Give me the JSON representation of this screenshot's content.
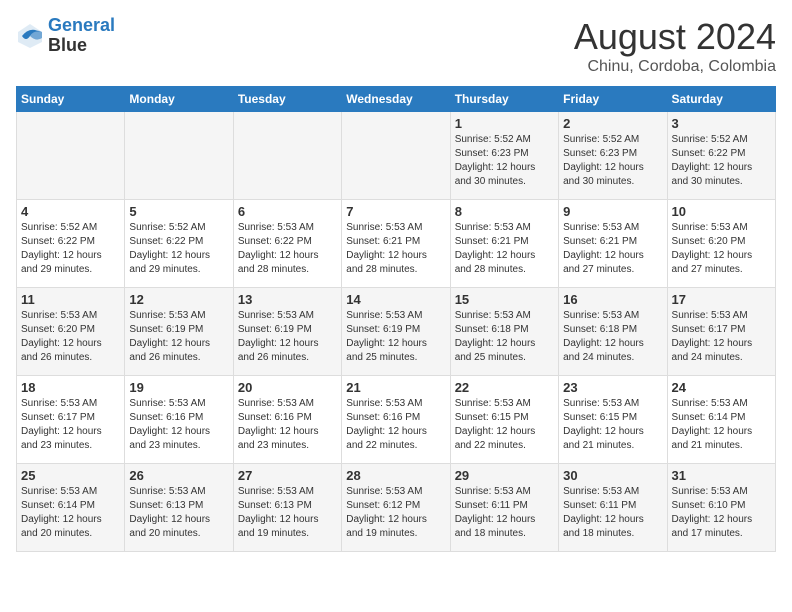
{
  "header": {
    "logo_line1": "General",
    "logo_line2": "Blue",
    "main_title": "August 2024",
    "sub_title": "Chinu, Cordoba, Colombia"
  },
  "weekdays": [
    "Sunday",
    "Monday",
    "Tuesday",
    "Wednesday",
    "Thursday",
    "Friday",
    "Saturday"
  ],
  "weeks": [
    [
      {
        "day": "",
        "info": ""
      },
      {
        "day": "",
        "info": ""
      },
      {
        "day": "",
        "info": ""
      },
      {
        "day": "",
        "info": ""
      },
      {
        "day": "1",
        "info": "Sunrise: 5:52 AM\nSunset: 6:23 PM\nDaylight: 12 hours\nand 30 minutes."
      },
      {
        "day": "2",
        "info": "Sunrise: 5:52 AM\nSunset: 6:23 PM\nDaylight: 12 hours\nand 30 minutes."
      },
      {
        "day": "3",
        "info": "Sunrise: 5:52 AM\nSunset: 6:22 PM\nDaylight: 12 hours\nand 30 minutes."
      }
    ],
    [
      {
        "day": "4",
        "info": "Sunrise: 5:52 AM\nSunset: 6:22 PM\nDaylight: 12 hours\nand 29 minutes."
      },
      {
        "day": "5",
        "info": "Sunrise: 5:52 AM\nSunset: 6:22 PM\nDaylight: 12 hours\nand 29 minutes."
      },
      {
        "day": "6",
        "info": "Sunrise: 5:53 AM\nSunset: 6:22 PM\nDaylight: 12 hours\nand 28 minutes."
      },
      {
        "day": "7",
        "info": "Sunrise: 5:53 AM\nSunset: 6:21 PM\nDaylight: 12 hours\nand 28 minutes."
      },
      {
        "day": "8",
        "info": "Sunrise: 5:53 AM\nSunset: 6:21 PM\nDaylight: 12 hours\nand 28 minutes."
      },
      {
        "day": "9",
        "info": "Sunrise: 5:53 AM\nSunset: 6:21 PM\nDaylight: 12 hours\nand 27 minutes."
      },
      {
        "day": "10",
        "info": "Sunrise: 5:53 AM\nSunset: 6:20 PM\nDaylight: 12 hours\nand 27 minutes."
      }
    ],
    [
      {
        "day": "11",
        "info": "Sunrise: 5:53 AM\nSunset: 6:20 PM\nDaylight: 12 hours\nand 26 minutes."
      },
      {
        "day": "12",
        "info": "Sunrise: 5:53 AM\nSunset: 6:19 PM\nDaylight: 12 hours\nand 26 minutes."
      },
      {
        "day": "13",
        "info": "Sunrise: 5:53 AM\nSunset: 6:19 PM\nDaylight: 12 hours\nand 26 minutes."
      },
      {
        "day": "14",
        "info": "Sunrise: 5:53 AM\nSunset: 6:19 PM\nDaylight: 12 hours\nand 25 minutes."
      },
      {
        "day": "15",
        "info": "Sunrise: 5:53 AM\nSunset: 6:18 PM\nDaylight: 12 hours\nand 25 minutes."
      },
      {
        "day": "16",
        "info": "Sunrise: 5:53 AM\nSunset: 6:18 PM\nDaylight: 12 hours\nand 24 minutes."
      },
      {
        "day": "17",
        "info": "Sunrise: 5:53 AM\nSunset: 6:17 PM\nDaylight: 12 hours\nand 24 minutes."
      }
    ],
    [
      {
        "day": "18",
        "info": "Sunrise: 5:53 AM\nSunset: 6:17 PM\nDaylight: 12 hours\nand 23 minutes."
      },
      {
        "day": "19",
        "info": "Sunrise: 5:53 AM\nSunset: 6:16 PM\nDaylight: 12 hours\nand 23 minutes."
      },
      {
        "day": "20",
        "info": "Sunrise: 5:53 AM\nSunset: 6:16 PM\nDaylight: 12 hours\nand 23 minutes."
      },
      {
        "day": "21",
        "info": "Sunrise: 5:53 AM\nSunset: 6:16 PM\nDaylight: 12 hours\nand 22 minutes."
      },
      {
        "day": "22",
        "info": "Sunrise: 5:53 AM\nSunset: 6:15 PM\nDaylight: 12 hours\nand 22 minutes."
      },
      {
        "day": "23",
        "info": "Sunrise: 5:53 AM\nSunset: 6:15 PM\nDaylight: 12 hours\nand 21 minutes."
      },
      {
        "day": "24",
        "info": "Sunrise: 5:53 AM\nSunset: 6:14 PM\nDaylight: 12 hours\nand 21 minutes."
      }
    ],
    [
      {
        "day": "25",
        "info": "Sunrise: 5:53 AM\nSunset: 6:14 PM\nDaylight: 12 hours\nand 20 minutes."
      },
      {
        "day": "26",
        "info": "Sunrise: 5:53 AM\nSunset: 6:13 PM\nDaylight: 12 hours\nand 20 minutes."
      },
      {
        "day": "27",
        "info": "Sunrise: 5:53 AM\nSunset: 6:13 PM\nDaylight: 12 hours\nand 19 minutes."
      },
      {
        "day": "28",
        "info": "Sunrise: 5:53 AM\nSunset: 6:12 PM\nDaylight: 12 hours\nand 19 minutes."
      },
      {
        "day": "29",
        "info": "Sunrise: 5:53 AM\nSunset: 6:11 PM\nDaylight: 12 hours\nand 18 minutes."
      },
      {
        "day": "30",
        "info": "Sunrise: 5:53 AM\nSunset: 6:11 PM\nDaylight: 12 hours\nand 18 minutes."
      },
      {
        "day": "31",
        "info": "Sunrise: 5:53 AM\nSunset: 6:10 PM\nDaylight: 12 hours\nand 17 minutes."
      }
    ]
  ]
}
